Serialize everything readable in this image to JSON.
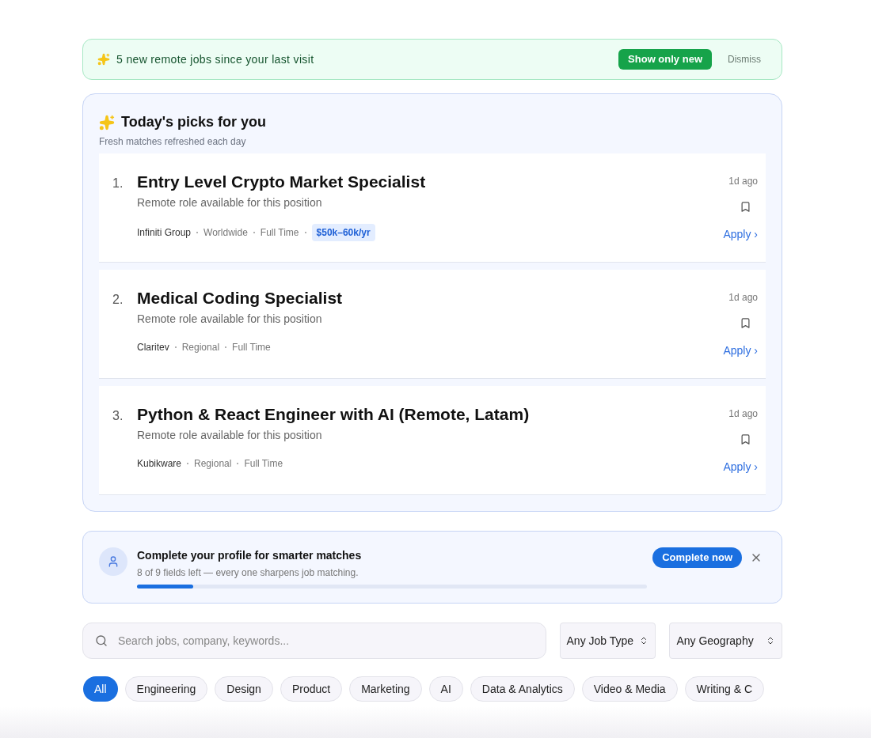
{
  "banner": {
    "text": "5 new remote jobs since your last visit",
    "action": "Show only new",
    "dismiss": "Dismiss"
  },
  "picks": {
    "title": "Today's picks for you",
    "subtitle": "Fresh matches refreshed each day",
    "jobs": [
      {
        "rank": "1.",
        "title": "Entry Level Crypto Market Specialist",
        "summary": "Remote role available for this position",
        "company": "Infiniti Group",
        "region": "Worldwide",
        "type": "Full Time",
        "salary": "$50k–60k/yr",
        "age": "1d ago",
        "saved": false,
        "apply": "Apply ›"
      },
      {
        "rank": "2.",
        "title": "Medical Coding Specialist",
        "summary": "Remote role available for this position",
        "company": "Claritev",
        "region": "Regional",
        "type": "Full Time",
        "age": "1d ago",
        "saved": false,
        "apply": "Apply ›"
      },
      {
        "rank": "3.",
        "title": "Python & React Engineer with AI (Remote, Latam)",
        "summary": "Remote role available for this position",
        "company": "Kubikware",
        "region": "Regional",
        "type": "Full Time",
        "age": "1d ago",
        "saved": false,
        "apply": "Apply ›"
      }
    ]
  },
  "profile": {
    "title": "Complete your profile for smarter matches",
    "subtitle": "8 of 9 fields left — every one sharpens job matching.",
    "level": 0.11,
    "action": "Complete now"
  },
  "search": {
    "placeholder": "Search jobs, company, keywords..."
  },
  "filters": [
    {
      "label": "Any Job Type"
    },
    {
      "label": "Any Geography"
    }
  ],
  "categories": [
    {
      "label": "All",
      "selected": true
    },
    {
      "label": "Engineering",
      "selected": false
    },
    {
      "label": "Design",
      "selected": false
    },
    {
      "label": "Product",
      "selected": false
    },
    {
      "label": "Marketing",
      "selected": false
    },
    {
      "label": "AI",
      "selected": false
    },
    {
      "label": "Data & Analytics",
      "selected": false
    },
    {
      "label": "Video & Media",
      "selected": false
    },
    {
      "label": "Writing & C",
      "selected": false
    }
  ]
}
